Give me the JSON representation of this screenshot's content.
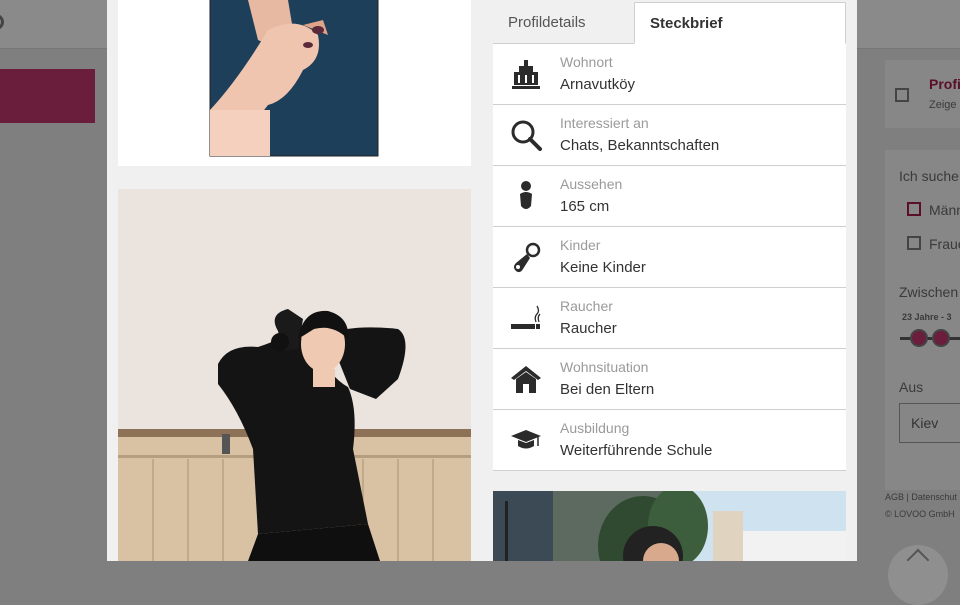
{
  "background": {
    "partial_link_title": "Profi",
    "partial_link_subtitle": "Zeige",
    "search_label": "Ich suche",
    "option_men": "Männ",
    "option_women": "Fraue",
    "age_label": "Zwischen",
    "age_range": "23 Jahre - 3",
    "from_label": "Aus",
    "city_value": "Kiev",
    "footer_links": "AGB | Datenschut",
    "footer_copyright": "© LOVOO GmbH"
  },
  "tabs": {
    "details_label": "Profildetails",
    "profile_label": "Steckbrief"
  },
  "profile_rows": [
    {
      "icon": "city-building-icon",
      "label": "Wohnort",
      "value": "Arnavutköy"
    },
    {
      "icon": "magnifier-icon",
      "label": "Interessiert an",
      "value": "Chats, Bekanntschaften"
    },
    {
      "icon": "person-silhouette-icon",
      "label": "Aussehen",
      "value": "165 cm"
    },
    {
      "icon": "pacifier-icon",
      "label": "Kinder",
      "value": "Keine Kinder"
    },
    {
      "icon": "cigarette-icon",
      "label": "Raucher",
      "value": "Raucher"
    },
    {
      "icon": "house-icon",
      "label": "Wohnsituation",
      "value": "Bei den Eltern"
    },
    {
      "icon": "graduation-cap-icon",
      "label": "Ausbildung",
      "value": "Weiterführende Schule"
    }
  ],
  "colors": {
    "accent": "#6a1e3c",
    "overlay": "#7f7f7f",
    "label_gray": "#9a9a9a",
    "text_dark": "#333333"
  }
}
